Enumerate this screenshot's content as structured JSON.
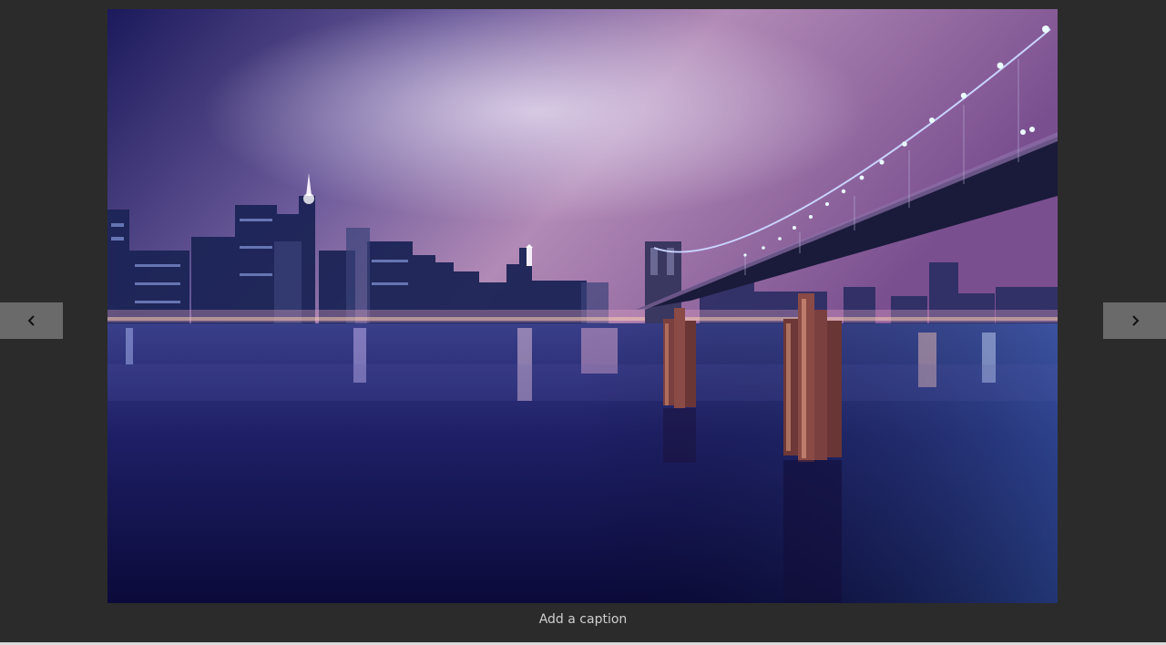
{
  "viewer": {
    "caption_placeholder": "Add a caption",
    "prev_icon": "chevron-left-icon",
    "next_icon": "chevron-right-icon"
  },
  "photo": {
    "subject": "night-city-skyline-bridge-photo"
  },
  "colors": {
    "background": "#2b2b2b",
    "nav_button": "#6a6a6a",
    "caption_text": "#cfcfcf"
  }
}
